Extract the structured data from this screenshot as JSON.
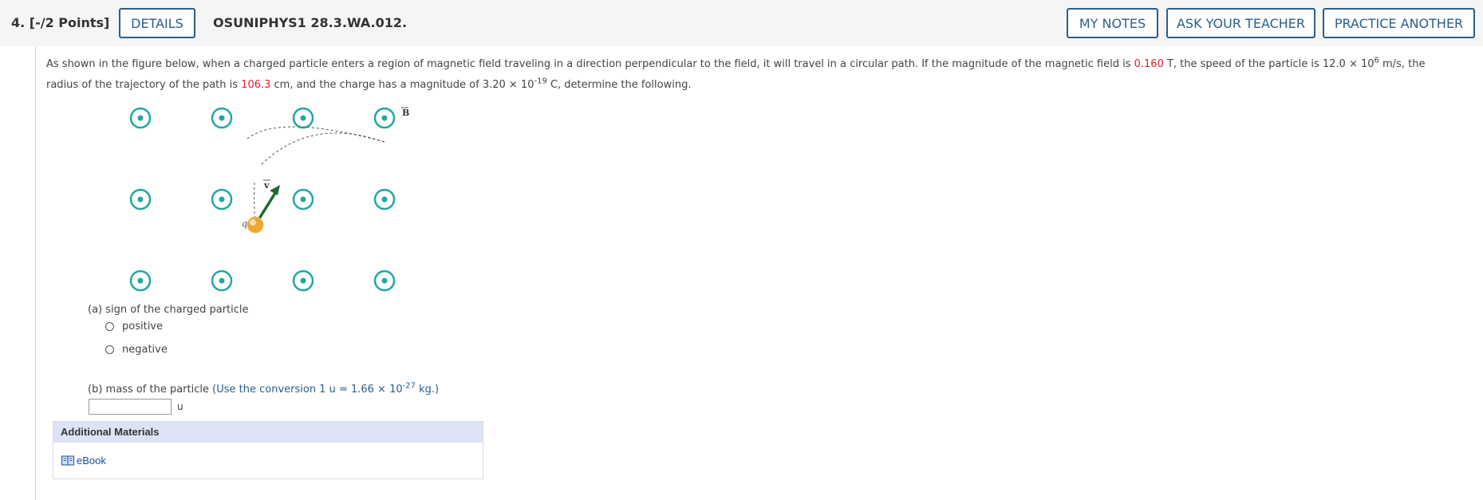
{
  "header": {
    "question_number": "4.  [-/2 Points]",
    "details_label": "DETAILS",
    "question_code": "OSUNIPHYS1 28.3.WA.012.",
    "my_notes_label": "MY NOTES",
    "ask_teacher_label": "ASK YOUR TEACHER",
    "practice_another_label": "PRACTICE ANOTHER"
  },
  "problem": {
    "text_1": "As shown in the figure below, when a charged particle enters a region of magnetic field traveling in a direction perpendicular to the field, it will travel in a circular path. If the magnitude of the magnetic field is ",
    "field_value": "0.160",
    "text_2": " T, the speed of the particle is 12.0 × 10",
    "speed_exp": "6",
    "text_3": " m/s, the radius of the trajectory of the path is ",
    "radius_value": "106.3",
    "text_4": " cm, and the charge has a magnitude of 3.20 × 10",
    "charge_exp": "-19",
    "text_5": " C, determine the following."
  },
  "figure": {
    "b_label": "B",
    "v_label": "v",
    "q_label": "q",
    "field_color": "#1fa8a0",
    "velocity_color": "#1e6b2e",
    "particle_color": "#f0a830"
  },
  "part_a": {
    "label": "(a) sign of the charged particle",
    "options": [
      "positive",
      "negative"
    ]
  },
  "part_b": {
    "label_1": "(b) mass of the particle ",
    "hint_1": "(Use the conversion 1 u = 1.66 × 10",
    "hint_exp": "-27",
    "hint_2": " kg.)",
    "unit": "u",
    "value": ""
  },
  "additional": {
    "title": "Additional Materials",
    "ebook_label": "eBook"
  }
}
